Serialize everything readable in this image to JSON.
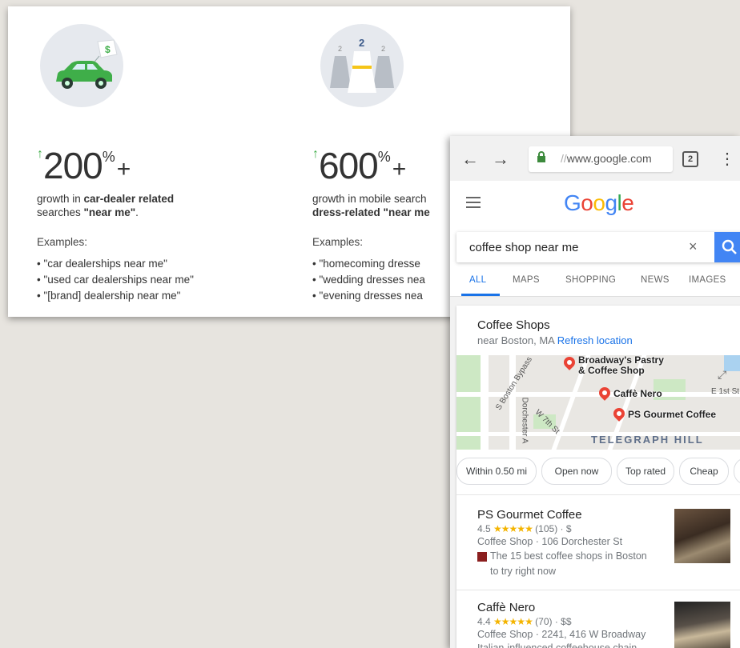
{
  "infographic": {
    "left": {
      "stat_number": "200",
      "stat_suffix": "%",
      "stat_plus": "+",
      "desc_start": "growth in ",
      "desc_bold": "car-dealer related",
      "desc_middle": " searches ",
      "desc_end_bold": "\"near me\"",
      "desc_period": ".",
      "examples_heading": "Examples:",
      "examples": [
        "\"car dealerships near me\"",
        "\"used car dealerships near me\"",
        "\"[brand] dealership near me\""
      ]
    },
    "right": {
      "stat_number": "600",
      "stat_suffix": "%",
      "stat_plus": "+",
      "desc_line1": "growth in mobile search",
      "desc_line2_bold": "dress-related \"near me",
      "examples_heading": "Examples:",
      "examples": [
        "\"homecoming dresse",
        "\"wedding dresses nea",
        "\"evening dresses nea"
      ],
      "tag_number": "2"
    },
    "car_tag": "$"
  },
  "browser": {
    "url_dim": "//",
    "url_main": "www.google.com",
    "tab_count": "2"
  },
  "google": {
    "logo": [
      "G",
      "o",
      "o",
      "g",
      "l",
      "e"
    ],
    "logo_colors": [
      "#4285f4",
      "#ea4335",
      "#fbbc05",
      "#4285f4",
      "#34a853",
      "#ea4335"
    ],
    "search_query": "coffee shop near me",
    "clear_symbol": "×",
    "tabs": [
      "ALL",
      "MAPS",
      "SHOPPING",
      "NEWS",
      "IMAGES"
    ]
  },
  "local": {
    "title": "Coffee Shops",
    "location": "near Boston, MA",
    "refresh": "Refresh location",
    "map": {
      "places": [
        "Broadway's Pastry",
        "& Coffee Shop",
        "Caffè Nero",
        "PS Gourmet Coffee"
      ],
      "streets": [
        "S Boston Bypass",
        "Dorchester A",
        "W 7th St",
        "E 1st St"
      ],
      "district": "TELEGRAPH HILL"
    },
    "chips": [
      "Within 0.50 mi",
      "Open now",
      "Top rated",
      "Cheap"
    ],
    "results": [
      {
        "name": "PS Gourmet Coffee",
        "rating": "4.5",
        "stars": "★★★★★",
        "reviews_price": "(105) · $",
        "meta": "Coffee Shop · 106 Dorchester St",
        "snippet": "The 15 best coffee shops in Boston to try right now"
      },
      {
        "name": "Caffè Nero",
        "rating": "4.4",
        "stars": "★★★★★",
        "reviews_price": "(70) · $$",
        "meta": "Coffee Shop · 2241, 416 W Broadway",
        "snippet": "Italian-influenced coffeehouse chain"
      }
    ]
  }
}
